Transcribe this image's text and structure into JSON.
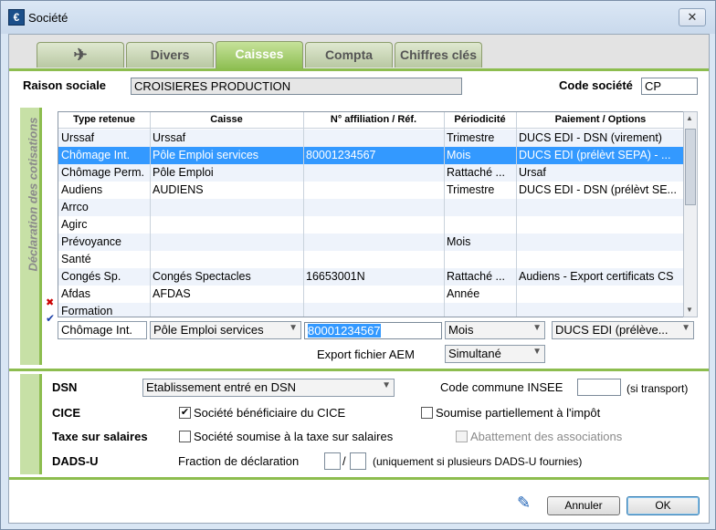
{
  "window": {
    "title": "Société",
    "close": "✕",
    "app_icon": "€"
  },
  "tabs": [
    {
      "label": "✈"
    },
    {
      "label": "Divers"
    },
    {
      "label": "Caisses"
    },
    {
      "label": "Compta"
    },
    {
      "label": "Chiffres clés"
    }
  ],
  "header": {
    "raison_label": "Raison sociale",
    "raison_value": "CROISIERES PRODUCTION",
    "code_label": "Code société",
    "code_value": "CP"
  },
  "cotisations": {
    "side_title": "Déclaration des cotisations",
    "columns": [
      "Type retenue",
      "Caisse",
      "N° affiliation / Réf.",
      "Périodicité",
      "Paiement / Options"
    ],
    "rows": [
      [
        "Urssaf",
        "Urssaf",
        "",
        "Trimestre",
        "DUCS EDI - DSN (virement)"
      ],
      [
        "Chômage Int.",
        "Pôle Emploi services",
        "80001234567",
        "Mois",
        "DUCS EDI (prélèvt SEPA) - ..."
      ],
      [
        "Chômage Perm.",
        "Pôle Emploi",
        "",
        "Rattaché ...",
        "Ursaf"
      ],
      [
        "Audiens",
        "AUDIENS",
        "",
        "Trimestre",
        "DUCS EDI - DSN (prélèvt SE..."
      ],
      [
        "Arrco",
        "",
        "",
        "",
        ""
      ],
      [
        "Agirc",
        "",
        "",
        "",
        ""
      ],
      [
        "Prévoyance",
        "",
        "",
        "Mois",
        ""
      ],
      [
        "Santé",
        "",
        "",
        "",
        ""
      ],
      [
        "Congés Sp.",
        "Congés Spectacles",
        "16653001N",
        "Rattaché ...",
        "Audiens - Export certificats CS"
      ],
      [
        "Afdas",
        "AFDAS",
        "",
        "Année",
        ""
      ],
      [
        "Formation",
        "",
        "",
        "",
        ""
      ]
    ],
    "row_markers": {
      "delete": "✖",
      "validate": "✔"
    },
    "editor": {
      "type": "Chômage Int.",
      "caisse": "Pôle Emploi services",
      "affiliation": "80001234567",
      "periodicite": "Mois",
      "paiement": "DUCS EDI (prélève..."
    },
    "export_label": "Export fichier AEM",
    "export_value": "Simultané"
  },
  "options": {
    "dsn_label": "DSN",
    "dsn_value": "Etablissement entré en DSN",
    "insee_label": "Code commune INSEE",
    "insee_value": "",
    "insee_hint": "(si transport)",
    "cice_label": "CICE",
    "cice_check_label": "Société bénéficiaire du CICE",
    "cice_checked": "✔",
    "soumise_label": "Soumise partiellement à l'impôt",
    "taxe_label": "Taxe sur salaires",
    "taxe_check_label": "Société soumise à la taxe sur salaires",
    "abattement_label": "Abattement des associations",
    "dadsu_label": "DADS-U",
    "fraction_label": "Fraction de déclaration",
    "fraction_sep": "/",
    "fraction_hint": "(uniquement si plusieurs DADS-U fournies)"
  },
  "footer": {
    "edit_icon": "✎",
    "cancel": "Annuler",
    "ok": "OK"
  }
}
